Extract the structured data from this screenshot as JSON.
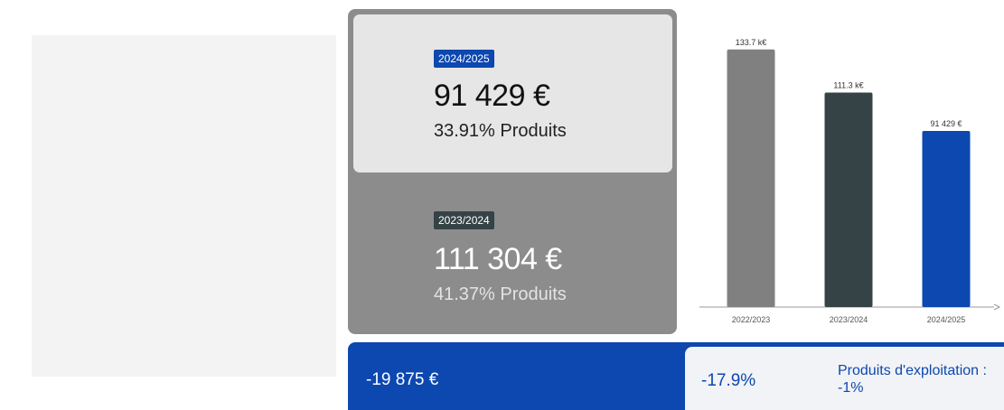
{
  "kpi": {
    "current": {
      "year": "2024/2025",
      "amount": "91 429 €",
      "share": "33.91% Produits"
    },
    "previous": {
      "year": "2023/2024",
      "amount": "111 304 €",
      "share": "41.37% Produits"
    }
  },
  "delta": {
    "amount": "-19 875 €",
    "percent": "-17.9%",
    "note": "Produits d'exploitation : -1%"
  },
  "colors": {
    "accent": "#0d47b0",
    "dark": "#364346",
    "grey": "#808080",
    "frame": "#8c8c8c"
  },
  "chart_data": {
    "type": "bar",
    "categories": [
      "2022/2023",
      "2023/2024",
      "2024/2025"
    ],
    "values": [
      133700,
      111304,
      91429
    ],
    "data_labels": [
      "133.7 k€",
      "111.3 k€",
      "91 429 €"
    ],
    "colors": [
      "#808080",
      "#364346",
      "#0d47b0"
    ],
    "ylim": [
      0,
      150000
    ],
    "grid": false,
    "legend": "none"
  }
}
